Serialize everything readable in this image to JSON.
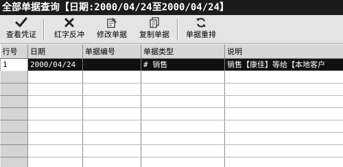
{
  "window": {
    "title": "全部单据查询【日期:2000/04/24至2000/04/24】"
  },
  "toolbar": {
    "buttons": [
      {
        "label": "查看凭证",
        "icon": "checkmark-icon"
      },
      {
        "label": "红字反冲",
        "icon": "x-mark-icon"
      },
      {
        "label": "修改单据",
        "icon": "edit-document-icon"
      },
      {
        "label": "复制单据",
        "icon": "copy-document-icon"
      },
      {
        "label": "单据重排",
        "icon": "refresh-icon"
      }
    ]
  },
  "grid": {
    "columns": [
      "行号",
      "日期",
      "单据编号",
      "单据类型",
      "说明"
    ],
    "rows": [
      {
        "row_no": "1",
        "date": "2000/04/24",
        "doc_no": "",
        "doc_type": "# 销售",
        "desc": "销售【康佳】等给【本地客户"
      }
    ],
    "empty_row_count": 8
  }
}
